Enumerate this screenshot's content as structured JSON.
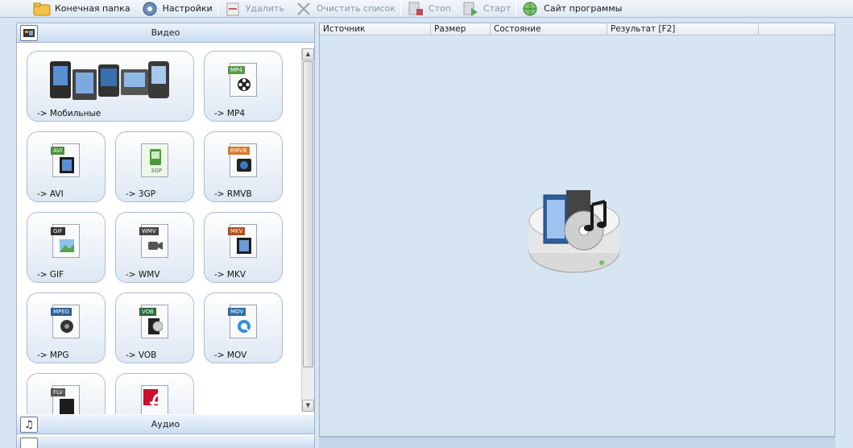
{
  "toolbar": {
    "output_folder": "Конечная папка",
    "settings": "Настройки",
    "delete": "Удалить",
    "clear_list": "Очистить список",
    "stop": "Стоп",
    "start": "Старт",
    "website": "Сайт программы"
  },
  "left": {
    "video_header": "Видео",
    "audio_header": "Аудио",
    "tiles": {
      "mobile": "-> Мобильные",
      "mp4": "-> MP4",
      "avi": "-> AVI",
      "3gp": "-> 3GP",
      "rmvb": "-> RMVB",
      "gif": "-> GIF",
      "wmv": "-> WMV",
      "mkv": "-> MKV",
      "mpg": "-> MPG",
      "vob": "-> VOB",
      "mov": "-> MOV"
    },
    "tags": {
      "mp4": "MP4",
      "avi": "AVI",
      "3gp": "3GP",
      "rmvb": "RMVB",
      "gif": "GIF",
      "wmv": "WMV",
      "mkv": "MKV",
      "mpeg": "MPEG",
      "vob": "VOB",
      "mov": "MOV",
      "flv": "FLV"
    }
  },
  "list": {
    "columns": [
      "Источник",
      "Размер",
      "Состояние",
      "Результат [F2]"
    ]
  },
  "colors": {
    "accent": "#3b6fb6",
    "panel_bg": "#d7e4f2",
    "tile_border": "#a8bfd9"
  }
}
